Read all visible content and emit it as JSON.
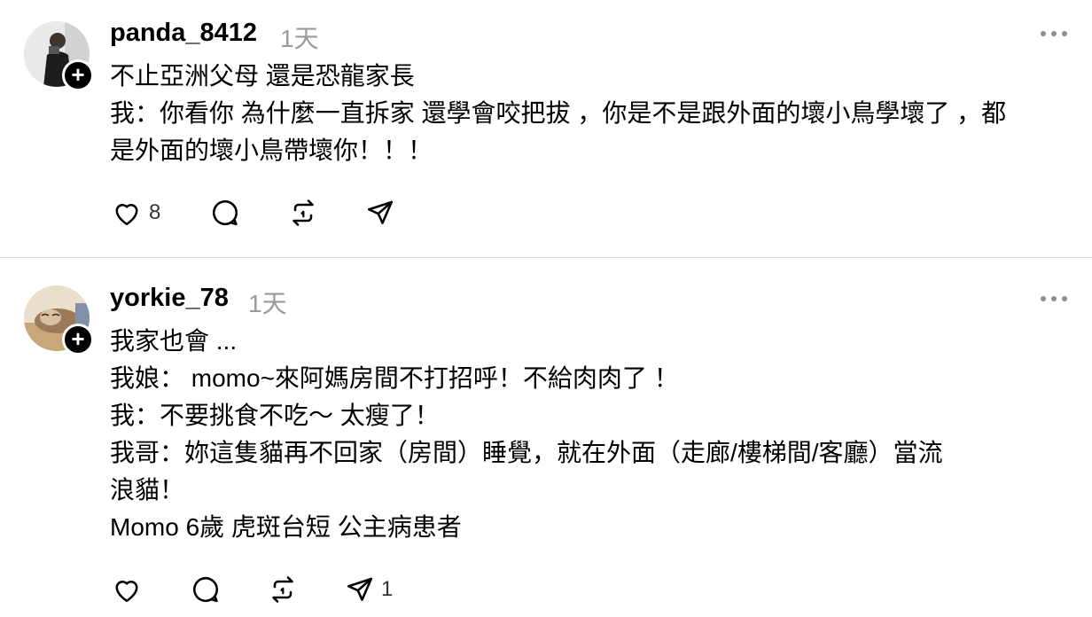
{
  "posts": [
    {
      "username": "panda_8412",
      "time": "1天",
      "lines": [
        "不止亞洲父母 還是恐龍家長",
        "我：你看你 為什麼一直拆家 還學會咬把拔 ，你是不是跟外面的壞小鳥學壞了 ，都",
        "是外面的壞小鳥帶壞你！！！"
      ],
      "like_count": "8",
      "share_count": ""
    },
    {
      "username": "yorkie_78",
      "time": "1天",
      "lines": [
        "我家也會 ...",
        "我娘： momo~來阿媽房間不打招呼！不給肉肉了 ！",
        "我：不要挑食不吃～ 太瘦了！",
        "我哥：妳這隻貓再不回家（房間）睡覺，就在外面（走廊/樓梯間/客廳）當流",
        "浪貓！",
        "Momo 6歲 虎斑台短 公主病患者"
      ],
      "like_count": "",
      "share_count": "1"
    }
  ],
  "icons": {
    "like": "heart-icon",
    "reply": "speech-bubble-icon",
    "repost": "repost-icon",
    "share": "send-icon",
    "follow": "plus-icon",
    "more": "more-horizontal-icon"
  },
  "colors": {
    "text": "#000000",
    "muted": "#9a9a9a",
    "divider": "#dcdcdc"
  }
}
